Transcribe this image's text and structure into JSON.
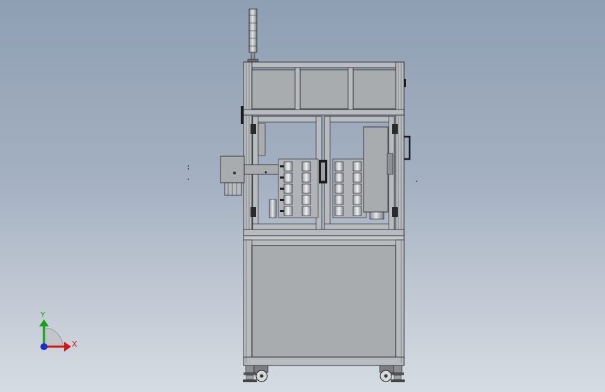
{
  "viewport": {
    "background_top": "#8f9fb3",
    "background_bottom": "#d6dce3"
  },
  "triad": {
    "x_label": "X",
    "y_label": "Y",
    "x_color": "#d01818",
    "y_color": "#18a018",
    "z_color": "#1830c8"
  },
  "model": {
    "frame_color": "#b8bcc0",
    "panel_color": "#a9acaf",
    "line_color": "#1c1c1c"
  }
}
